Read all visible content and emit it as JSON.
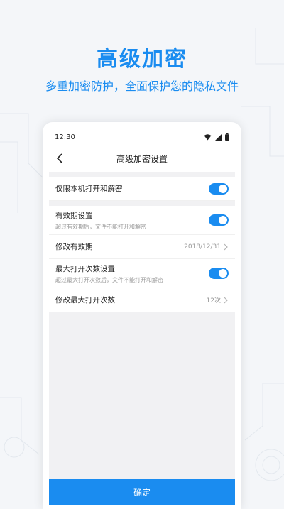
{
  "promo": {
    "title": "高级加密",
    "subtitle": "多重加密防护，全面保护您的隐私文件"
  },
  "status_bar": {
    "time": "12:30"
  },
  "nav": {
    "title": "高级加密设置"
  },
  "settings": {
    "local_only": {
      "label": "仅限本机打开和解密",
      "enabled": true
    },
    "expiry": {
      "label": "有效期设置",
      "desc": "超过有效期后，文件不能打开和解密",
      "enabled": true
    },
    "edit_expiry": {
      "label": "修改有效期",
      "value": "2018/12/31"
    },
    "max_opens": {
      "label": "最大打开次数设置",
      "desc": "超过最大打开次数后，文件不能打开和解密",
      "enabled": true
    },
    "edit_max_opens": {
      "label": "修改最大打开次数",
      "value": "12次"
    }
  },
  "footer": {
    "confirm_label": "确定"
  },
  "colors": {
    "accent": "#1a8cf0",
    "page_bg": "#f4f6f9",
    "screen_bg": "#f1f1f3"
  }
}
